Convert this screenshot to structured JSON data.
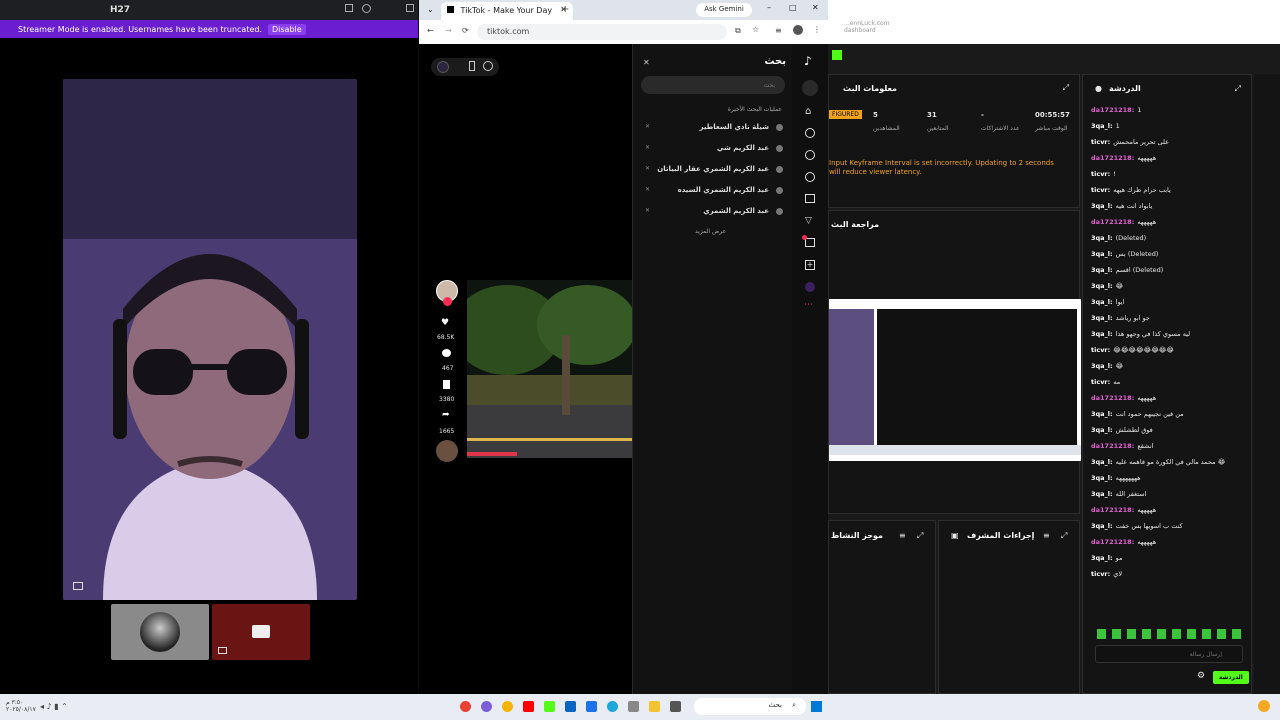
{
  "discord": {
    "window_title": "H27",
    "streamer_banner": "Streamer Mode is enabled. Usernames have been truncated.",
    "disable_label": "Disable"
  },
  "browser": {
    "tab_title": "TikTok - Make Your Day",
    "ask_gemini": "Ask Gemini",
    "url": "tiktok.com"
  },
  "tiktok": {
    "search_title": "بحث",
    "search_placeholder": "بحث",
    "recent_header": "عمليات البحث الأخيرة",
    "recent_searches": [
      "شيلة نادي السعاطير",
      "عبد الكريم شي",
      "عبد الكريم الشمري عقار البياتان",
      "عبد الكريم الشمري السيده",
      "عبد الكريم الشمري"
    ],
    "show_more": "عرض المزيد",
    "likes": "68.5K",
    "comments": "467",
    "saves": "3380",
    "shares": "1665"
  },
  "dashboard": {
    "header_line1": "...ennLuck.com",
    "header_line2": "dashboard",
    "stream_info_title": "معلومات البث",
    "chat_title": "الدردشة",
    "status_badge": "FIGURED",
    "stats": [
      {
        "value": "5",
        "label": "المشاهدين"
      },
      {
        "value": "31",
        "label": "المتابعين"
      },
      {
        "value": "-",
        "label": "عدد الاشتراكات"
      },
      {
        "value": "00:55:57",
        "label": "الوقت مباشر"
      }
    ],
    "warning": "Input Keyframe Interval is set incorrectly. Updating to 2 seconds will reduce viewer latency.",
    "preview_title": "مراجعة البث",
    "summary_title": "موجز النشاط",
    "mod_actions_title": "إجراءات المشرف",
    "chat_placeholder": "إرسال رسالة",
    "chat_button": "الدردشة",
    "chat": [
      {
        "user": "da1721218:",
        "msg": "1",
        "c": "u"
      },
      {
        "user": "3qa_l:",
        "msg": "1",
        "c": "u2"
      },
      {
        "user": "ticvr:",
        "msg": "على تحرير مامحمش",
        "c": "u2"
      },
      {
        "user": "da1721218:",
        "msg": "هههههه",
        "c": "u"
      },
      {
        "user": "ticvr:",
        "msg": "!",
        "c": "u2"
      },
      {
        "user": "ticvr:",
        "msg": "يابب حرام ظرك هيهه",
        "c": "u2"
      },
      {
        "user": "3qa_l:",
        "msg": "يابواد انت هيه",
        "c": "u2"
      },
      {
        "user": "da1721218:",
        "msg": "هههههه",
        "c": "u"
      },
      {
        "user": "3qa_l:",
        "msg": "(Deleted)",
        "c": "u2"
      },
      {
        "user": "3qa_l:",
        "msg": "بس (Deleted)",
        "c": "u2"
      },
      {
        "user": "3qa_l:",
        "msg": "اقسم (Deleted)",
        "c": "u2"
      },
      {
        "user": "3qa_l:",
        "msg": "😂",
        "c": "u2"
      },
      {
        "user": "3qa_l:",
        "msg": "ايوا",
        "c": "u2"
      },
      {
        "user": "3qa_l:",
        "msg": "جو ابو رياشد",
        "c": "u2"
      },
      {
        "user": "3qa_l:",
        "msg": "ليه مسوي كذا في وجهو هذا",
        "c": "u2"
      },
      {
        "user": "ticvr:",
        "msg": "😂😂😂😂😂😂😂😂",
        "c": "u2"
      },
      {
        "user": "3qa_l:",
        "msg": "😂",
        "c": "u2"
      },
      {
        "user": "ticvr:",
        "msg": "مه",
        "c": "u2"
      },
      {
        "user": "da1721218:",
        "msg": "هههههه",
        "c": "u"
      },
      {
        "user": "3qa_l:",
        "msg": "من فين تجيبهم حمود انت",
        "c": "u2"
      },
      {
        "user": "3qa_l:",
        "msg": "فوق لطشلش",
        "c": "u2"
      },
      {
        "user": "da1721218:",
        "msg": "انشقع",
        "c": "u"
      },
      {
        "user": "3qa_l:",
        "msg": "محمد مالي في الكورة مو فاهمه عليه 😂",
        "c": "u2"
      },
      {
        "user": "3qa_l:",
        "msg": "هههههههه",
        "c": "u2"
      },
      {
        "user": "3qa_l:",
        "msg": "استغفر الله",
        "c": "u2"
      },
      {
        "user": "da1721218:",
        "msg": "هههههه",
        "c": "u"
      },
      {
        "user": "3qa_l:",
        "msg": "كنت ب اسويها بس خفت",
        "c": "u2"
      },
      {
        "user": "da1721218:",
        "msg": "هههههه",
        "c": "u"
      },
      {
        "user": "3qa_l:",
        "msg": "مو",
        "c": "u2"
      },
      {
        "user": "ticvr:",
        "msg": "لاي",
        "c": "u2"
      }
    ]
  },
  "taskbar": {
    "search_label": "بحث",
    "time": "٣:٥٠ م",
    "date": "٢٠٢٥/٠٨/١٧"
  }
}
